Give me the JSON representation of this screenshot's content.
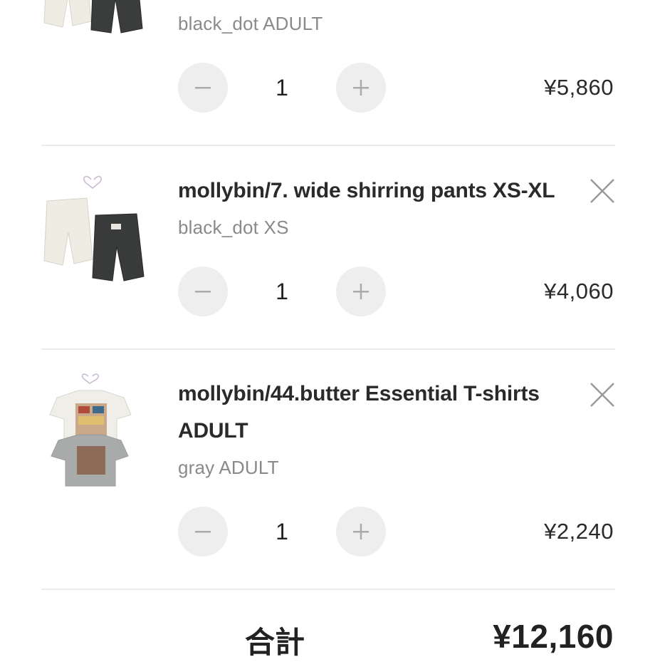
{
  "cart": {
    "items": [
      {
        "title": "",
        "variant": "black_dot ADULT",
        "quantity": "1",
        "price": "¥5,860",
        "image_icon": "pants-product-thumbnail"
      },
      {
        "title": "mollybin/7. wide shirring pants XS-XL",
        "variant": "black_dot XS",
        "quantity": "1",
        "price": "¥4,060",
        "image_icon": "pants-product-thumbnail"
      },
      {
        "title_line1": "mollybin/44.butter Essential T-shirts",
        "title_line2": "ADULT",
        "variant": "gray ADULT",
        "quantity": "1",
        "price": "¥2,240",
        "image_icon": "tshirt-product-thumbnail"
      }
    ],
    "controls": {
      "minus_icon": "minus-icon",
      "plus_icon": "plus-icon",
      "remove_icon": "close-icon"
    },
    "total": {
      "label": "合計",
      "value": "¥12,160"
    },
    "colors": {
      "text": "#2a2a2a",
      "muted": "#8a8a8a",
      "button_bg": "#eeeeee",
      "divider": "#ececec"
    }
  }
}
